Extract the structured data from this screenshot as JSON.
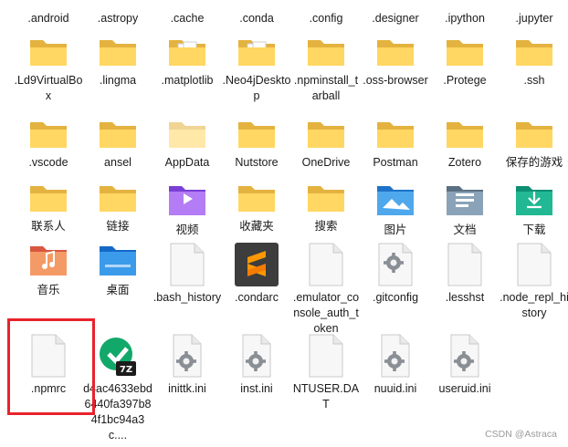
{
  "colors": {
    "folder_back": "#E4B23E",
    "folder_front": "#FFD762",
    "file_body": "#F7F7F7",
    "file_stroke": "#C9C9C9",
    "highlight": "#E8232C"
  },
  "rows": [
    {
      "labels_only": true,
      "items": [
        {
          "label": ".android",
          "icon": "folder-icon"
        },
        {
          "label": ".astropy",
          "icon": "folder-icon"
        },
        {
          "label": ".cache",
          "icon": "folder-icon"
        },
        {
          "label": ".conda",
          "icon": "folder-icon"
        },
        {
          "label": ".config",
          "icon": "folder-icon"
        },
        {
          "label": ".designer",
          "icon": "folder-icon"
        },
        {
          "label": ".ipython",
          "icon": "folder-icon"
        },
        {
          "label": ".jupyter",
          "icon": "folder-icon"
        }
      ]
    },
    {
      "items": [
        {
          "label": ".Ld9VirtualBox",
          "icon": "folder-icon"
        },
        {
          "label": ".lingma",
          "icon": "folder-icon"
        },
        {
          "label": ".matplotlib",
          "icon": "folder-with-files-icon"
        },
        {
          "label": ".Neo4jDesktop",
          "icon": "folder-with-files-icon"
        },
        {
          "label": ".npminstall_tarball",
          "icon": "folder-icon"
        },
        {
          "label": ".oss-browser",
          "icon": "folder-icon"
        },
        {
          "label": ".Protege",
          "icon": "folder-icon"
        },
        {
          "label": ".ssh",
          "icon": "folder-icon"
        }
      ]
    },
    {
      "items": [
        {
          "label": ".vscode",
          "icon": "folder-icon"
        },
        {
          "label": "ansel",
          "icon": "folder-icon"
        },
        {
          "label": "AppData",
          "icon": "folder-faded-icon"
        },
        {
          "label": "Nutstore",
          "icon": "folder-icon"
        },
        {
          "label": "OneDrive",
          "icon": "folder-icon"
        },
        {
          "label": "Postman",
          "icon": "folder-icon"
        },
        {
          "label": "Zotero",
          "icon": "folder-icon"
        },
        {
          "label": "保存的游戏",
          "icon": "folder-icon"
        }
      ]
    },
    {
      "items": [
        {
          "label": "联系人",
          "icon": "folder-icon"
        },
        {
          "label": "链接",
          "icon": "folder-icon"
        },
        {
          "label": "视频",
          "icon": "videos-folder-icon"
        },
        {
          "label": "收藏夹",
          "icon": "folder-icon"
        },
        {
          "label": "搜索",
          "icon": "folder-icon"
        },
        {
          "label": "图片",
          "icon": "pictures-folder-icon"
        },
        {
          "label": "文档",
          "icon": "documents-folder-icon"
        },
        {
          "label": "下载",
          "icon": "downloads-folder-icon"
        }
      ]
    },
    {
      "items": [
        {
          "label": "音乐",
          "icon": "music-folder-icon"
        },
        {
          "label": "桌面",
          "icon": "desktop-folder-icon"
        },
        {
          "label": ".bash_history",
          "icon": "file-icon"
        },
        {
          "label": ".condarc",
          "icon": "sublime-text-icon"
        },
        {
          "label": ".emulator_console_auth_token",
          "icon": "file-icon"
        },
        {
          "label": ".gitconfig",
          "icon": "gear-file-icon"
        },
        {
          "label": ".lesshst",
          "icon": "file-icon"
        },
        {
          "label": ".node_repl_history",
          "icon": "file-icon"
        }
      ]
    },
    {
      "items": [
        {
          "label": ".npmrc",
          "icon": "file-icon"
        },
        {
          "label": "d4ac4633ebd6440fa397b84f1bc94a3c....",
          "icon": "7zip-archive-icon"
        },
        {
          "label": "inittk.ini",
          "icon": "settings-file-icon"
        },
        {
          "label": "inst.ini",
          "icon": "settings-file-icon"
        },
        {
          "label": "NTUSER.DAT",
          "icon": "file-icon"
        },
        {
          "label": "nuuid.ini",
          "icon": "settings-file-icon"
        },
        {
          "label": "useruid.ini",
          "icon": "settings-file-icon"
        }
      ]
    }
  ],
  "watermark": "CSDN @Astraca"
}
